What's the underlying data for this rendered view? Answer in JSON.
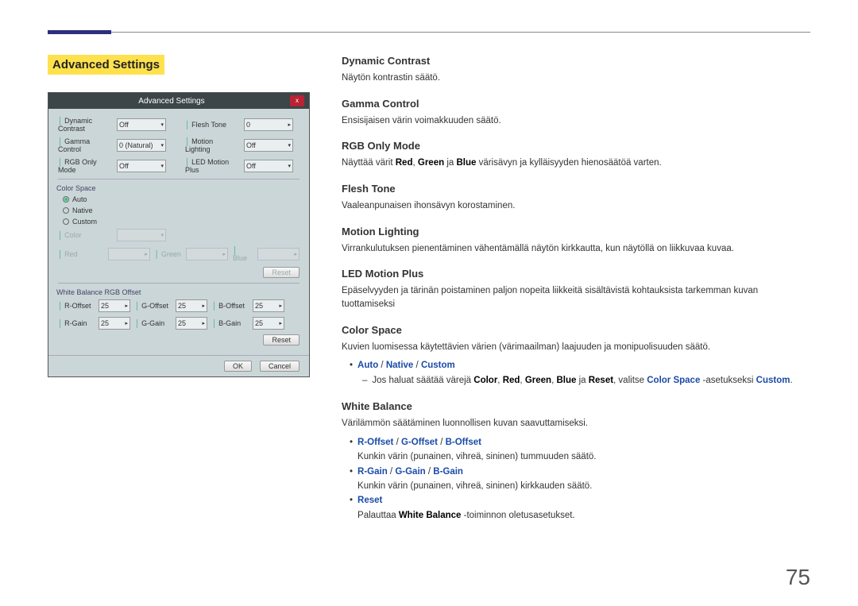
{
  "section_label": "Advanced Settings",
  "dialog": {
    "title": "Advanced Settings",
    "close": "x",
    "rows_top": [
      {
        "label": "Dynamic Contrast",
        "val": "Off",
        "label2": "Flesh Tone",
        "val2": "0"
      },
      {
        "label": "Gamma Control",
        "val": "0 (Natural)",
        "label2": "Motion Lighting",
        "val2": "Off"
      },
      {
        "label": "RGB Only Mode",
        "val": "Off",
        "label2": "LED Motion Plus",
        "val2": "Off"
      }
    ],
    "color_space": {
      "title": "Color Space",
      "options": [
        "Auto",
        "Native",
        "Custom"
      ],
      "selected": "Auto",
      "color_label": "Color",
      "rgb": [
        {
          "label": "Red",
          "val": ""
        },
        {
          "label": "Green",
          "val": ""
        },
        {
          "label": "Blue",
          "val": ""
        }
      ],
      "reset": "Reset"
    },
    "wb_title": "White Balance RGB Offset",
    "wb_rows": [
      {
        "a": "R-Offset",
        "av": "25",
        "b": "G-Offset",
        "bv": "25",
        "c": "B-Offset",
        "cv": "25"
      },
      {
        "a": "R-Gain",
        "av": "25",
        "b": "G-Gain",
        "bv": "25",
        "c": "B-Gain",
        "cv": "25"
      }
    ],
    "wb_reset": "Reset",
    "ok": "OK",
    "cancel": "Cancel"
  },
  "sections": {
    "dynamic_contrast": {
      "h": "Dynamic Contrast",
      "d": "Näytön kontrastin säätö."
    },
    "gamma_control": {
      "h": "Gamma Control",
      "d": "Ensisijaisen värin voimakkuuden säätö."
    },
    "rgb_only_mode": {
      "h": "RGB Only Mode",
      "d_pre": "Näyttää värit ",
      "d_mid": " ja ",
      "d_post": " värisävyn ja kylläisyyden hienosäätöä varten.",
      "red": "Red",
      "green": "Green",
      "blue": "Blue"
    },
    "flesh_tone": {
      "h": "Flesh Tone",
      "d": "Vaaleanpunaisen ihonsävyn korostaminen."
    },
    "motion_lighting": {
      "h": "Motion Lighting",
      "d": "Virrankulutuksen pienentäminen vähentämällä näytön kirkkautta, kun näytöllä on liikkuvaa kuvaa."
    },
    "led_motion_plus": {
      "h": "LED Motion Plus",
      "d": "Epäselvyyden ja tärinän poistaminen paljon nopeita liikkeitä sisältävistä kohtauksista tarkemman kuvan tuottamiseksi"
    },
    "color_space": {
      "h": "Color Space",
      "d": "Kuvien luomisessa käytettävien värien (värimaailman) laajuuden ja monipuolisuuden säätö.",
      "modes": {
        "auto": "Auto",
        "native": "Native",
        "custom": "Custom"
      },
      "dash_pre": "Jos haluat säätää värejä ",
      "dash_items": {
        "color": "Color",
        "red": "Red",
        "green": "Green",
        "blue": "Blue",
        "reset": "Reset"
      },
      "dash_mid": ", valitse ",
      "dash_cs": "Color Space",
      "dash_post": " -asetukseksi ",
      "dash_custom": "Custom",
      "period": "."
    },
    "white_balance": {
      "h": "White Balance",
      "d": "Värilämmön säätäminen luonnollisen kuvan saavuttamiseksi.",
      "b1": {
        "r": "R-Offset",
        "g": "G-Offset",
        "b": "B-Offset"
      },
      "b1_desc": "Kunkin värin (punainen, vihreä, sininen) tummuuden säätö.",
      "b2": {
        "r": "R-Gain",
        "g": "G-Gain",
        "b": "B-Gain"
      },
      "b2_desc": "Kunkin värin (punainen, vihreä, sininen) kirkkauden säätö.",
      "b3": "Reset",
      "b3_pre": "Palauttaa ",
      "b3_wb": "White Balance",
      "b3_post": " -toiminnon oletusasetukset."
    }
  },
  "slashes": " / ",
  "comma": ", ",
  "ja": " ja ",
  "page_number": "75"
}
